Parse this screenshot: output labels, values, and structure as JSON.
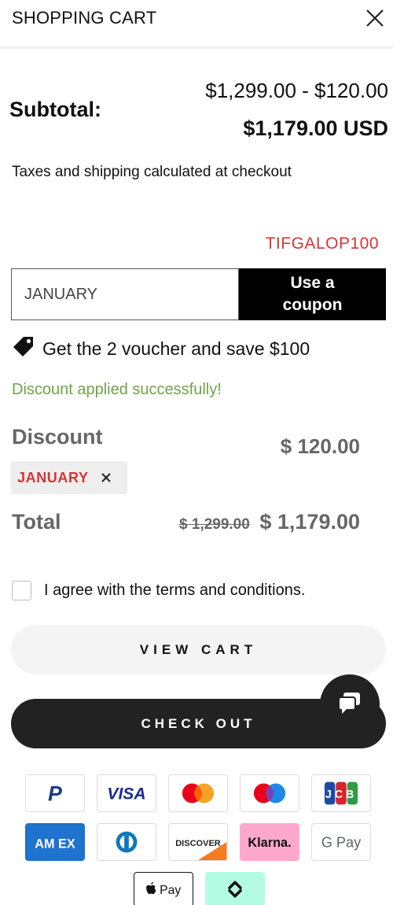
{
  "header": {
    "title": "SHOPPING CART"
  },
  "subtotal": {
    "label": "Subtotal:",
    "calc": "$1,299.00 - $120.00",
    "total": "$1,179.00 USD"
  },
  "taxes_note": "Taxes and shipping calculated at checkout",
  "coupon": {
    "code_hint": "TIFGALOP100",
    "input_value": "JANUARY",
    "button_label_line1": "Use a",
    "button_label_line2": "coupon"
  },
  "voucher_text": "Get the 2 voucher and save $100",
  "success_message": "Discount applied successfully!",
  "discount": {
    "label": "Discount",
    "value": "$ 120.00",
    "chip_label": "JANUARY"
  },
  "total": {
    "label": "Total",
    "original": "$ 1,299.00",
    "final": "$ 1,179.00"
  },
  "terms_label": "I agree with the terms and conditions.",
  "buttons": {
    "view_cart": "VIEW CART",
    "checkout": "CHECK OUT"
  },
  "payment_methods": [
    {
      "name": "PayPal",
      "icon": "paypal-icon",
      "label": "P"
    },
    {
      "name": "Visa",
      "icon": "visa-icon",
      "label": "VISA"
    },
    {
      "name": "Mastercard",
      "icon": "mastercard-icon",
      "label": ""
    },
    {
      "name": "Maestro",
      "icon": "maestro-icon",
      "label": ""
    },
    {
      "name": "JCB",
      "icon": "jcb-icon",
      "label": "JCB"
    },
    {
      "name": "American Express",
      "icon": "amex-icon",
      "label": "AM EX"
    },
    {
      "name": "Diners Club",
      "icon": "diners-icon",
      "label": ""
    },
    {
      "name": "Discover",
      "icon": "discover-icon",
      "label": "DISCOVER"
    },
    {
      "name": "Klarna",
      "icon": "klarna-icon",
      "label": "Klarna."
    },
    {
      "name": "Google Pay",
      "icon": "google-pay-icon",
      "label": "G Pay"
    },
    {
      "name": "Apple Pay",
      "icon": "apple-pay-icon",
      "label": "Pay"
    },
    {
      "name": "Afterpay",
      "icon": "afterpay-icon",
      "label": ""
    }
  ],
  "colors": {
    "accent_red": "#d83434",
    "success_green": "#6ea34a",
    "button_dark": "#222222",
    "muted_text": "#666666"
  }
}
